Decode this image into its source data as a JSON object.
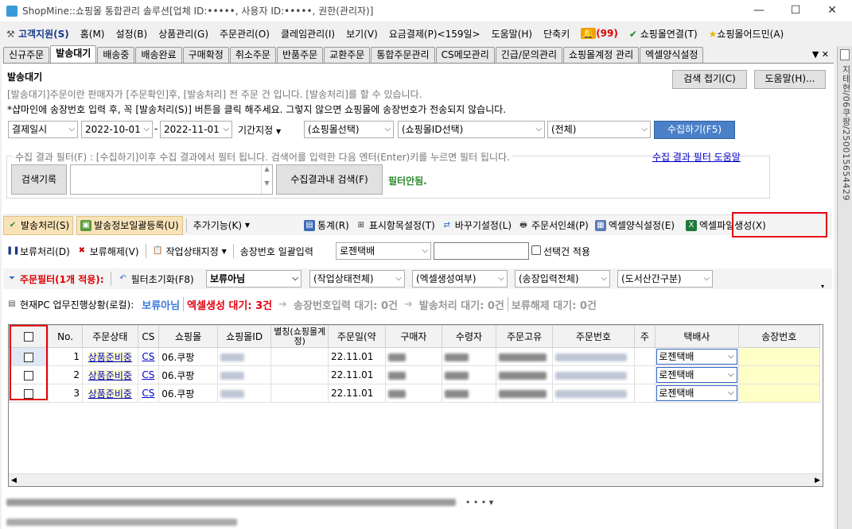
{
  "window": {
    "title": "ShopMine::쇼핑몰 통합관리 솔루션[업체 ID:•••••, 사용자 ID:•••••, 권한(관리자)]",
    "minimize": "—",
    "maximize": "☐",
    "close": "✕"
  },
  "menu": [
    "고객지원(S)",
    "홈(M)",
    "설정(B)",
    "상품관리(G)",
    "주문관리(O)",
    "클레임관리(I)",
    "보기(V)",
    "요금결제(P)<159일>",
    "도움말(H)",
    "단축키",
    "(99)",
    "쇼핑몰연결(T)",
    "쇼핑몰어드민(A)"
  ],
  "tabs": [
    "신규주문",
    "발송대기",
    "배송중",
    "배송완료",
    "구매확정",
    "취소주문",
    "반품주문",
    "교환주문",
    "통합주문관리",
    "CS메모관리",
    "긴급/문의관리",
    "쇼핑몰계정 관리",
    "엑셀양식설정"
  ],
  "tab_tail": "▼ ✕",
  "side_text": "지테현/06쿠팡/250015654429",
  "page": {
    "title": "발송대기",
    "desc1": "[발송대기]주문이란 판매자가 [주문확인]후, [발송처리] 전 주문 건 입니다. [발송처리]를 할 수 있습니다.",
    "desc2": "*샵마인에 송장번호 입력 후, 꼭 [발송처리(S)] 버튼을 클릭 해주세요. 그렇지 않으면 쇼핑몰에 송장번호가 전송되지 않습니다.",
    "fold_button": "검색 접기(C)",
    "help_button": "도움말(H)..."
  },
  "search": {
    "date_type": "결제일시",
    "date_from": "2022-10-01",
    "dash": "-",
    "date_to": "2022-11-01",
    "period": "기간지정",
    "mall": "(쇼핑몰선택)",
    "mall_id": "(쇼핑몰ID선택)",
    "all": "(전체)",
    "collect_button": "수집하기(F5)"
  },
  "filter": {
    "legend": "수집 결과 필터(F) : [수집하기]이후 수집 결과에서 필터 됩니다. 검색어를 입력한 다음 엔터(Enter)키를 누르면 필터 됩니다.",
    "help_link": "수집 결과 필터 도움말",
    "history_button": "검색기록",
    "search_in_button": "수집결과내 검색(F)",
    "status": "필터안됨."
  },
  "toolbar1": {
    "ship": "발송처리(S)",
    "bulk_reg": "발송정보일괄등록(U)",
    "more": "추가기능(K)",
    "stats": "통계(R)",
    "cols": "표시항목설정(T)",
    "barcode": "바꾸기설정(L)",
    "print": "주문서인쇄(P)",
    "excel_setting": "엑셀양식설정(E)",
    "excel_create": "엑셀파일생성(X)"
  },
  "toolbar2": {
    "hold": "보류처리(D)",
    "unhold": "보류해제(V)",
    "work_status": "작업상태지정",
    "invoice_label": "송장번호 일괄입력",
    "courier": "로젠택배",
    "invoice_value": "",
    "apply_selected": "선택건 적용"
  },
  "toolbar3": {
    "order_filter": "주문필터(1개 적용):",
    "reset": "필터초기화(F8)",
    "hold_filter": "보류아님",
    "work_filter": "(작업상태전체)",
    "excel_filter": "(엑셀생성여부)",
    "invoice_filter": "(송장입력전체)",
    "island_filter": "(도서산간구분)"
  },
  "progress": {
    "label": "현재PC 업무진행상황(로컬):",
    "s1": "보류아님",
    "s2": "엑셀생성 대기: 3건",
    "s3": "송장번호입력 대기: 0건",
    "s4": "발송처리 대기: 0건",
    "s5": "보류해제 대기: 0건",
    "arrow": "➔"
  },
  "grid": {
    "headers": [
      "",
      "No.",
      "주문상태",
      "CS",
      "쇼핑몰",
      "쇼핑몰ID",
      "별칭(쇼핑몰계정)",
      "주문일(약",
      "구매자",
      "수령자",
      "주문고유",
      "주문번호",
      "주",
      "택배사",
      "송장번호"
    ],
    "rows": [
      {
        "no": "1",
        "status": "상품준비중",
        "cs": "CS",
        "mall": "06.쿠팡",
        "date": "22.11.01",
        "courier": "로젠택배",
        "invoice": ""
      },
      {
        "no": "2",
        "status": "상품준비중",
        "cs": "CS",
        "mall": "06.쿠팡",
        "date": "22.11.01",
        "courier": "로젠택배",
        "invoice": ""
      },
      {
        "no": "3",
        "status": "상품준비중",
        "cs": "CS",
        "mall": "06.쿠팡",
        "date": "22.11.01",
        "courier": "로젠택배",
        "invoice": ""
      }
    ]
  },
  "statusbar": {
    "more": "• • • ▾"
  }
}
